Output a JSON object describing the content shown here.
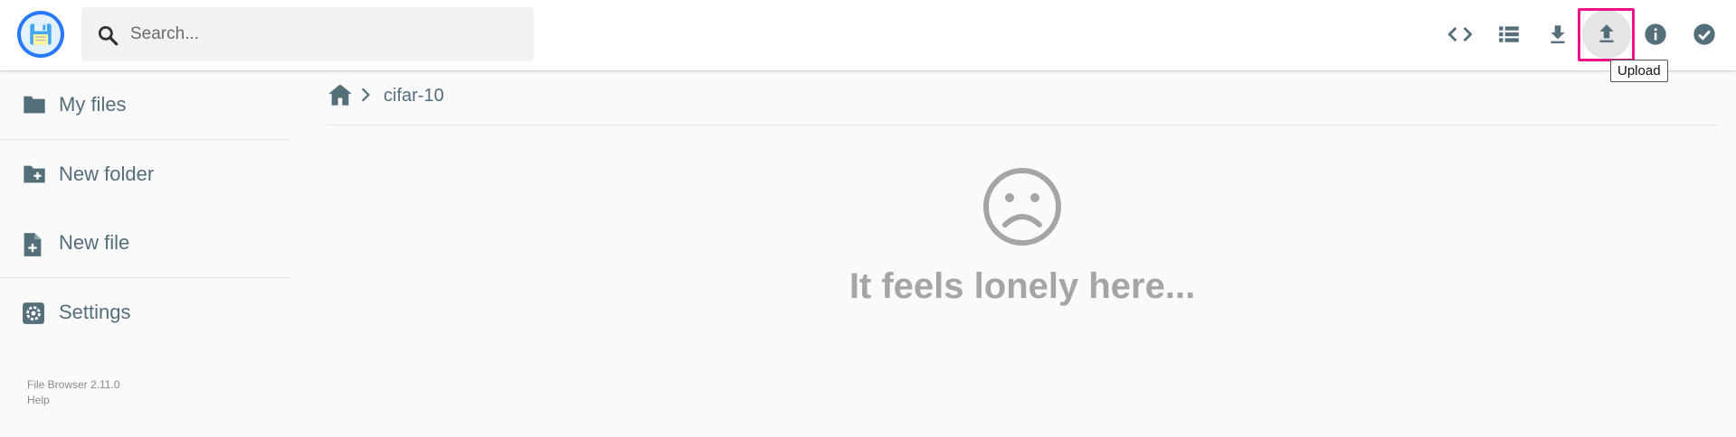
{
  "app": {
    "logo_icon": "floppy-disk-icon"
  },
  "search": {
    "placeholder": "Search..."
  },
  "toolbar": {
    "buttons": [
      {
        "name": "code-view-icon",
        "tooltip": ""
      },
      {
        "name": "list-view-icon",
        "tooltip": ""
      },
      {
        "name": "download-icon",
        "tooltip": ""
      },
      {
        "name": "upload-icon",
        "tooltip": "Upload",
        "active": true
      },
      {
        "name": "info-icon",
        "tooltip": ""
      },
      {
        "name": "check-circle-icon",
        "tooltip": ""
      }
    ],
    "tooltip_text": "Upload"
  },
  "sidebar": {
    "items": [
      {
        "label": "My files",
        "icon": "folder-icon"
      },
      {
        "label": "New folder",
        "icon": "create-new-folder-icon"
      },
      {
        "label": "New file",
        "icon": "note-add-icon"
      },
      {
        "label": "Settings",
        "icon": "settings-icon"
      }
    ],
    "version": "File Browser 2.11.0",
    "help": "Help"
  },
  "breadcrumb": {
    "home_icon": "home-icon",
    "current": "cifar-10"
  },
  "empty_state": {
    "icon": "sad-face-icon",
    "message": "It feels lonely here..."
  },
  "colors": {
    "accent": "#2979ff",
    "text": "#546e7a",
    "highlight": "#ee1188",
    "muted": "#a5a5a5"
  }
}
